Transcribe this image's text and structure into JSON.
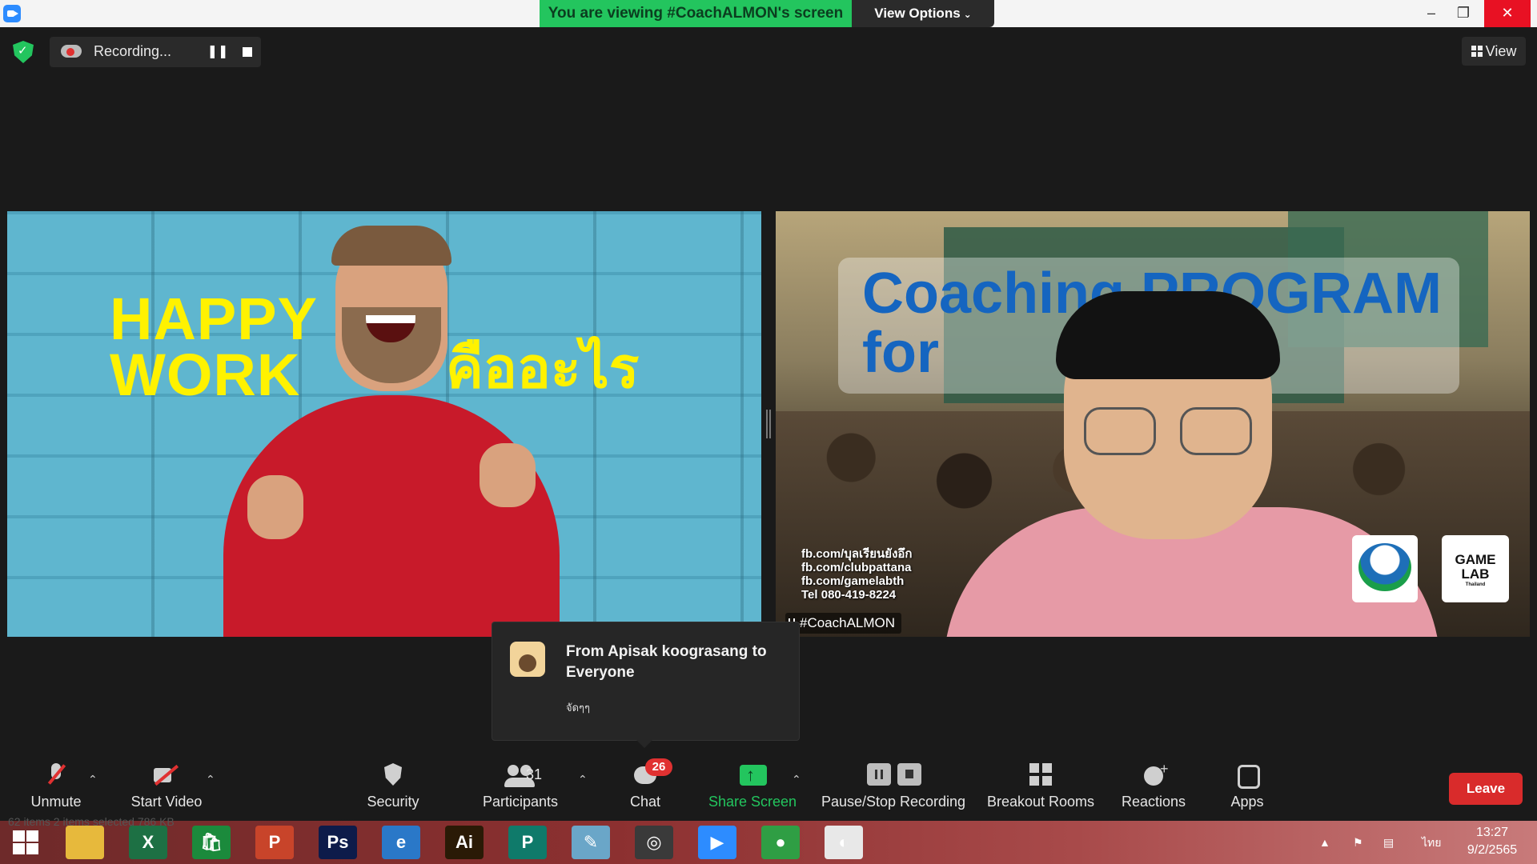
{
  "window": {
    "banner": "You are viewing #CoachALMON's screen",
    "view_options": "View Options",
    "minimize": "–",
    "restore": "❐",
    "close": "✕"
  },
  "recording": {
    "label": "Recording...",
    "pause_icon": "❚❚"
  },
  "view_button": "View",
  "tiles": {
    "left": {
      "headline_line1": "HAPPY",
      "headline_line2": "WORK",
      "thai": "คืออะไร"
    },
    "right": {
      "title_line1": "Coaching PROGRAM",
      "title_line2": "for          er",
      "contact_lines": [
        "fb.com/บุลเรียนยังอึก",
        "fb.com/clubpattana",
        "fb.com/gamelabth",
        "Tel 080-419-8224"
      ],
      "logo2_main": "GAME LAB",
      "logo2_sub": "Thailand",
      "name_tag": "#CoachALMON"
    }
  },
  "chat_notification": {
    "from": "From Apisak koograsang to Everyone",
    "message": "จัดๆๆ"
  },
  "toolbar": {
    "unmute": "Unmute",
    "start_video": "Start Video",
    "security": "Security",
    "participants": "Participants",
    "participants_count": "31",
    "chat": "Chat",
    "chat_badge": "26",
    "share_screen": "Share Screen",
    "pause_stop_recording": "Pause/Stop Recording",
    "breakout_rooms": "Breakout Rooms",
    "reactions": "Reactions",
    "apps": "Apps",
    "leave": "Leave",
    "caret": "⌃"
  },
  "taskbar": {
    "overlay": "62 items    2 items selected  786 KB",
    "apps": [
      {
        "name": "file-explorer",
        "label": "",
        "color": "#e7b93c"
      },
      {
        "name": "excel",
        "label": "X",
        "color": "#1d7044"
      },
      {
        "name": "store",
        "label": "🛍",
        "color": "#1b8a3c"
      },
      {
        "name": "powerpoint",
        "label": "P",
        "color": "#c8442a"
      },
      {
        "name": "photoshop",
        "label": "Ps",
        "color": "#0d1b4a"
      },
      {
        "name": "internet-explorer",
        "label": "e",
        "color": "#2a78c8"
      },
      {
        "name": "illustrator",
        "label": "Ai",
        "color": "#2a1a06"
      },
      {
        "name": "publisher",
        "label": "P",
        "color": "#0f7a6a"
      },
      {
        "name": "notepad",
        "label": "✎",
        "color": "#6aa6c8"
      },
      {
        "name": "photoscape",
        "label": "◎",
        "color": "#3a3a3a"
      },
      {
        "name": "zoom",
        "label": "▶",
        "color": "#2d8cff"
      },
      {
        "name": "chrome",
        "label": "●",
        "color": "#2f9e44"
      },
      {
        "name": "paint",
        "label": "◐",
        "color": "#e8e8e8"
      }
    ],
    "language": "ไทย",
    "time": "13:27",
    "date": "9/2/2565"
  },
  "colors": {
    "accent_green": "#23c55e",
    "leave_red": "#d92b2b",
    "badge_red": "#e03131",
    "title_blue": "#1565c0",
    "headline_yellow": "#fff200"
  }
}
